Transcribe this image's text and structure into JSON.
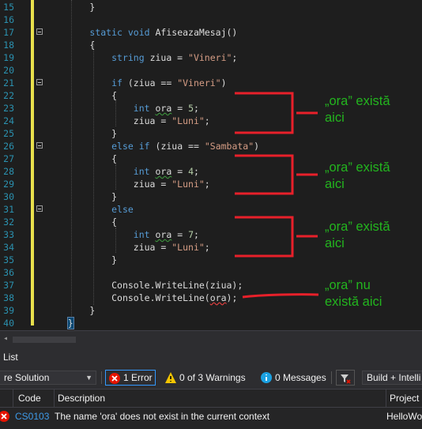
{
  "editor": {
    "line_numbers": [
      "15",
      "16",
      "17",
      "18",
      "19",
      "20",
      "21",
      "22",
      "23",
      "24",
      "25",
      "26",
      "27",
      "28",
      "29",
      "30",
      "31",
      "32",
      "33",
      "34",
      "35",
      "36",
      "37",
      "38",
      "39",
      "40"
    ],
    "code_lines": [
      {
        "indent": "        ",
        "tokens": [
          {
            "t": "}",
            "c": "id"
          }
        ]
      },
      {
        "indent": "",
        "tokens": []
      },
      {
        "indent": "        ",
        "tokens": [
          {
            "t": "static",
            "c": "kw"
          },
          {
            "t": " ",
            "c": "id"
          },
          {
            "t": "void",
            "c": "kw"
          },
          {
            "t": " AfiseazaMesaj()",
            "c": "id"
          }
        ]
      },
      {
        "indent": "        ",
        "tokens": [
          {
            "t": "{",
            "c": "id"
          }
        ]
      },
      {
        "indent": "            ",
        "tokens": [
          {
            "t": "string",
            "c": "kw"
          },
          {
            "t": " ziua = ",
            "c": "id"
          },
          {
            "t": "\"Vineri\"",
            "c": "str"
          },
          {
            "t": ";",
            "c": "id"
          }
        ]
      },
      {
        "indent": "",
        "tokens": []
      },
      {
        "indent": "            ",
        "tokens": [
          {
            "t": "if",
            "c": "kw"
          },
          {
            "t": " (ziua == ",
            "c": "id"
          },
          {
            "t": "\"Vineri\"",
            "c": "str"
          },
          {
            "t": ")",
            "c": "id"
          }
        ]
      },
      {
        "indent": "            ",
        "tokens": [
          {
            "t": "{",
            "c": "id"
          }
        ]
      },
      {
        "indent": "                ",
        "tokens": [
          {
            "t": "int",
            "c": "kw"
          },
          {
            "t": " ",
            "c": "id"
          },
          {
            "t": "ora",
            "c": "id squig"
          },
          {
            "t": " = ",
            "c": "id"
          },
          {
            "t": "5",
            "c": "num"
          },
          {
            "t": ";",
            "c": "id"
          }
        ]
      },
      {
        "indent": "                ",
        "tokens": [
          {
            "t": "ziua = ",
            "c": "id"
          },
          {
            "t": "\"Luni\"",
            "c": "str"
          },
          {
            "t": ";",
            "c": "id"
          }
        ]
      },
      {
        "indent": "            ",
        "tokens": [
          {
            "t": "}",
            "c": "id"
          }
        ]
      },
      {
        "indent": "            ",
        "tokens": [
          {
            "t": "else",
            "c": "kw"
          },
          {
            "t": " ",
            "c": "id"
          },
          {
            "t": "if",
            "c": "kw"
          },
          {
            "t": " (ziua == ",
            "c": "id"
          },
          {
            "t": "\"Sambata\"",
            "c": "str"
          },
          {
            "t": ")",
            "c": "id"
          }
        ]
      },
      {
        "indent": "            ",
        "tokens": [
          {
            "t": "{",
            "c": "id"
          }
        ]
      },
      {
        "indent": "                ",
        "tokens": [
          {
            "t": "int",
            "c": "kw"
          },
          {
            "t": " ",
            "c": "id"
          },
          {
            "t": "ora",
            "c": "id squig"
          },
          {
            "t": " = ",
            "c": "id"
          },
          {
            "t": "4",
            "c": "num"
          },
          {
            "t": ";",
            "c": "id"
          }
        ]
      },
      {
        "indent": "                ",
        "tokens": [
          {
            "t": "ziua = ",
            "c": "id"
          },
          {
            "t": "\"Luni\"",
            "c": "str"
          },
          {
            "t": ";",
            "c": "id"
          }
        ]
      },
      {
        "indent": "            ",
        "tokens": [
          {
            "t": "}",
            "c": "id"
          }
        ]
      },
      {
        "indent": "            ",
        "tokens": [
          {
            "t": "else",
            "c": "kw"
          }
        ]
      },
      {
        "indent": "            ",
        "tokens": [
          {
            "t": "{",
            "c": "id"
          }
        ]
      },
      {
        "indent": "                ",
        "tokens": [
          {
            "t": "int",
            "c": "kw"
          },
          {
            "t": " ",
            "c": "id"
          },
          {
            "t": "ora",
            "c": "id squig"
          },
          {
            "t": " = ",
            "c": "id"
          },
          {
            "t": "7",
            "c": "num"
          },
          {
            "t": ";",
            "c": "id"
          }
        ]
      },
      {
        "indent": "                ",
        "tokens": [
          {
            "t": "ziua = ",
            "c": "id"
          },
          {
            "t": "\"Luni\"",
            "c": "str"
          },
          {
            "t": ";",
            "c": "id"
          }
        ]
      },
      {
        "indent": "            ",
        "tokens": [
          {
            "t": "}",
            "c": "id"
          }
        ]
      },
      {
        "indent": "",
        "tokens": []
      },
      {
        "indent": "            ",
        "tokens": [
          {
            "t": "Console",
            "c": "id"
          },
          {
            "t": ".WriteLine(ziua);",
            "c": "id"
          }
        ]
      },
      {
        "indent": "            ",
        "tokens": [
          {
            "t": "Console",
            "c": "id"
          },
          {
            "t": ".WriteLine(",
            "c": "id"
          },
          {
            "t": "ora",
            "c": "id squig-red"
          },
          {
            "t": ");",
            "c": "id"
          }
        ]
      },
      {
        "indent": "        ",
        "tokens": [
          {
            "t": "}",
            "c": "id"
          }
        ]
      },
      {
        "indent": "    ",
        "tokens": [
          {
            "t": "}",
            "c": "id sel-brace"
          }
        ]
      }
    ],
    "annotations": [
      {
        "line1": "„ora” există",
        "line2": "aici"
      },
      {
        "line1": "„ora” există",
        "line2": "aici"
      },
      {
        "line1": "„ora” există",
        "line2": "aici"
      },
      {
        "line1": "„ora” nu",
        "line2": "există aici"
      }
    ],
    "colors": {
      "annotation": "#23b51e",
      "bracket": "#e8202a"
    }
  },
  "error_list": {
    "title": "List",
    "scope": "re Solution",
    "errors_label": "1 Error",
    "warnings_label": "0 of 3 Warnings",
    "messages_label": "0 Messages",
    "build_label": "Build + Intelli",
    "columns": {
      "code": "Code",
      "description": "Description",
      "project": "Project"
    },
    "rows": [
      {
        "code": "CS0103",
        "description": "The name 'ora' does not exist in the current context",
        "project": "HelloWo"
      }
    ]
  }
}
